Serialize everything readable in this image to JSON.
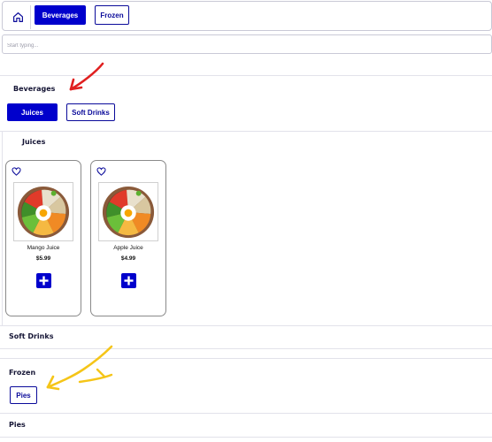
{
  "nav": {
    "home_icon": "home-icon",
    "tabs": [
      {
        "label": "Beverages",
        "active": true
      },
      {
        "label": "Frozen",
        "active": false
      }
    ]
  },
  "search": {
    "placeholder": "Start typing..."
  },
  "sections": {
    "beverages": {
      "title": "Beverages",
      "subtabs": [
        {
          "label": "Juices",
          "active": true
        },
        {
          "label": "Soft Drinks",
          "active": false
        }
      ],
      "juices": {
        "title": "Juices",
        "products": [
          {
            "name": "Mango Juice",
            "price": "$5.99"
          },
          {
            "name": "Apple Juice",
            "price": "$4.99"
          }
        ]
      },
      "soft_drinks": {
        "title": "Soft Drinks"
      }
    },
    "frozen": {
      "title": "Frozen",
      "subtabs": [
        {
          "label": "Pies",
          "active": false
        }
      ],
      "pies": {
        "title": "Pies"
      }
    }
  },
  "colors": {
    "primary": "#0000cc",
    "annotation_red": "#e02020",
    "annotation_yellow": "#f5c518"
  }
}
